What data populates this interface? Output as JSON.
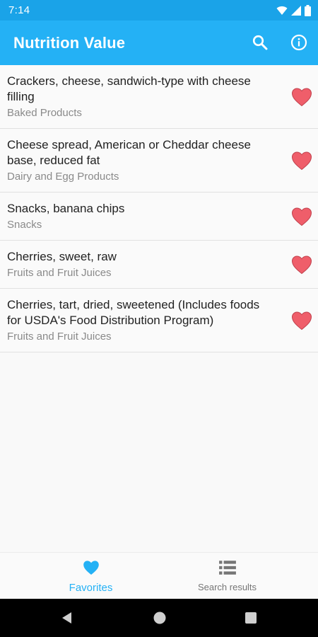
{
  "status_bar": {
    "time": "7:14",
    "icons": [
      "wifi-icon",
      "signal-icon",
      "battery-icon"
    ]
  },
  "app_bar": {
    "title": "Nutrition Value",
    "actions": [
      "search-icon",
      "info-icon"
    ],
    "color": "#24b1f5"
  },
  "items": [
    {
      "name": "Crackers, cheese, sandwich-type with cheese filling",
      "category": "Baked Products",
      "favorite": true
    },
    {
      "name": "Cheese spread, American or Cheddar cheese base, reduced fat",
      "category": "Dairy and Egg Products",
      "favorite": true
    },
    {
      "name": "Snacks, banana chips",
      "category": "Snacks",
      "favorite": true
    },
    {
      "name": "Cherries, sweet, raw",
      "category": "Fruits and Fruit Juices",
      "favorite": true
    },
    {
      "name": "Cherries, tart, dried, sweetened (Includes foods for USDA's Food Distribution Program)",
      "category": "Fruits and Fruit Juices",
      "favorite": true
    }
  ],
  "bottom_nav": {
    "favorites_label": "Favorites",
    "search_results_label": "Search results",
    "active": "favorites",
    "active_color": "#24b1f5",
    "inactive_color": "#757575"
  },
  "heart_color": "#ef5e6a"
}
